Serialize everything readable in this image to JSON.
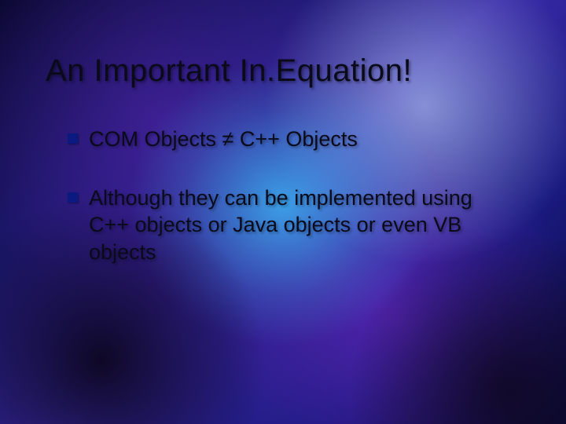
{
  "slide": {
    "title": "An Important In.Equation!",
    "bullets": [
      {
        "text": "COM Objects ≠ C++ Objects"
      },
      {
        "text": "Although they can be implemented using C++ objects or Java objects or even VB objects"
      }
    ]
  }
}
